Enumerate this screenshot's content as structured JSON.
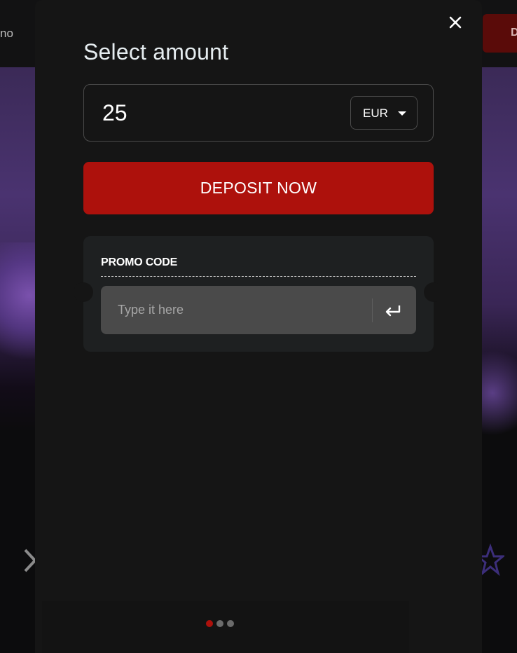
{
  "background": {
    "nav_fragment": "no",
    "top_button_fragment": "D"
  },
  "modal": {
    "title": "Select amount",
    "close_icon": "close-icon",
    "amount": {
      "value": "25",
      "currency": "EUR"
    },
    "deposit_button_label": "DEPOSIT NOW",
    "promo": {
      "title": "PROMO CODE",
      "placeholder": "Type it here",
      "submit_icon": "enter-arrow-icon"
    },
    "pagination": {
      "total": 3,
      "active": 1,
      "active_color": "#ad110c",
      "inactive_color": "#6b6b6b"
    }
  },
  "colors": {
    "accent": "#ad110c",
    "modal_bg": "#151515",
    "promo_card_bg": "#1e2021",
    "promo_field_bg": "#4a4a4a"
  }
}
